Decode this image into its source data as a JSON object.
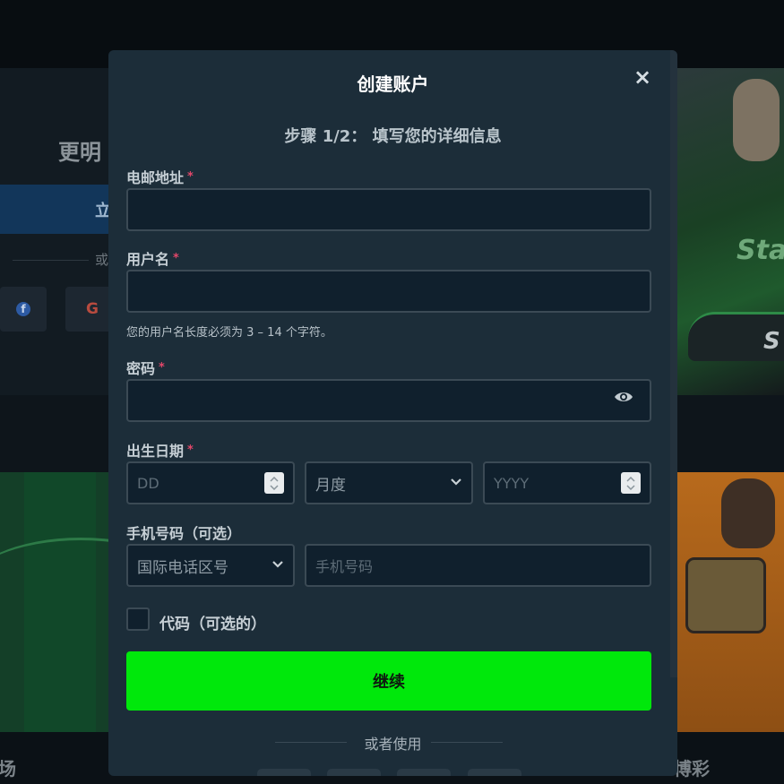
{
  "background": {
    "hero_title": "更明",
    "cta_label": "立",
    "or_label": "或",
    "facebook_glyph": "f",
    "google_glyph": "G",
    "sponsor_text": "Sta",
    "car_text": "S",
    "bottom_left_label": "场",
    "bottom_right_label": "博彩"
  },
  "modal": {
    "title": "创建账户",
    "close_glyph": "×",
    "subtitle": "步骤 1/2： 填写您的详细信息",
    "required_mark": "*",
    "email": {
      "label": "电邮地址",
      "value": ""
    },
    "username": {
      "label": "用户名",
      "value": "",
      "hint": "您的用户名长度必须为 3 – 14 个字符。"
    },
    "password": {
      "label": "密码",
      "value": "",
      "icon": "eye-icon"
    },
    "birthdate": {
      "label": "出生日期",
      "day_placeholder": "DD",
      "month_selected": "月度",
      "year_placeholder": "YYYY"
    },
    "phone": {
      "label": "手机号码（可选）",
      "country_code_selected": "国际电话区号",
      "number_placeholder": "手机号码"
    },
    "promo_code": {
      "label": "代码（可选的）",
      "checked": false
    },
    "continue_label": "继续",
    "or_use_label": "或者使用"
  },
  "colors": {
    "modal_bg": "#1c2d39",
    "input_bg": "#10202d",
    "input_border": "#3b4a55",
    "accent_green": "#00e80b",
    "required_red": "#e2476a"
  }
}
